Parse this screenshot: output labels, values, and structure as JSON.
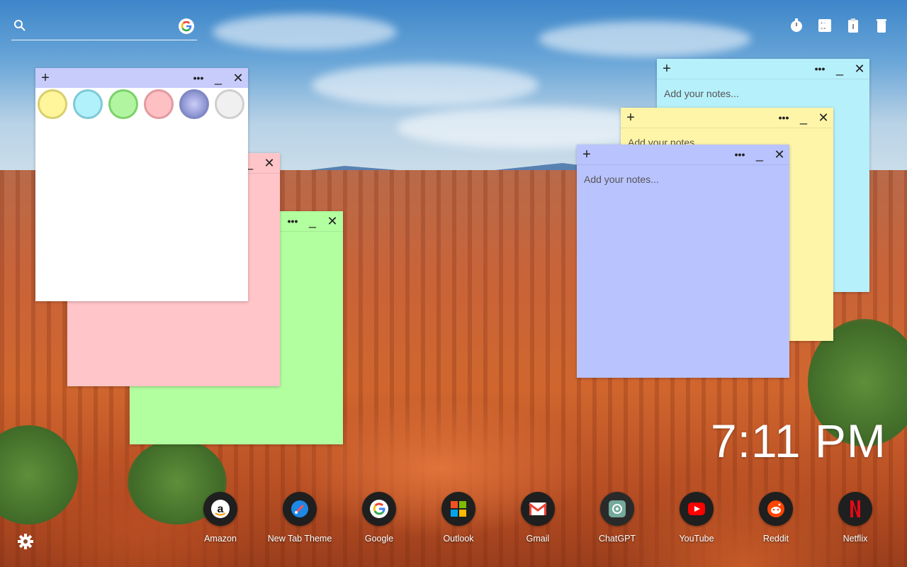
{
  "search": {
    "placeholder": "",
    "icon": "search-icon",
    "engine_icon": "google-icon"
  },
  "top_tools": [
    {
      "icon": "timer-icon"
    },
    {
      "icon": "calculator-icon"
    },
    {
      "icon": "clipboard-icon"
    },
    {
      "icon": "trash-icon"
    }
  ],
  "notes": {
    "placeholder": "Add your notes...",
    "new_label": "+",
    "menu_label": "•••",
    "minimize_label": "_",
    "close_label": "✕",
    "colors": {
      "white": "#ffffff",
      "pink": "#ffc5c8",
      "green": "#b2ffa0",
      "cyan": "#b6f0fb",
      "yellow": "#fff5a8",
      "blue": "#b9c3fe",
      "header_blue": "#c7ccfb"
    },
    "palette": [
      {
        "name": "yellow",
        "fill": "#fff59a",
        "ring": "#d9cf6e"
      },
      {
        "name": "cyan",
        "fill": "#b0f1fb",
        "ring": "#80c9d4"
      },
      {
        "name": "green",
        "fill": "#b1f5a0",
        "ring": "#7dd16b"
      },
      {
        "name": "pink",
        "fill": "#ffc0c4",
        "ring": "#e39aa0"
      },
      {
        "name": "blue",
        "fill": "#aab0e6",
        "ring": "#7f88c4",
        "selected": true
      },
      {
        "name": "white",
        "fill": "#f0f0f0",
        "ring": "#cfcfcf"
      }
    ]
  },
  "clock": {
    "time": "7:11 PM"
  },
  "dock": [
    {
      "label": "Amazon",
      "icon": "amazon-icon"
    },
    {
      "label": "New Tab Theme",
      "icon": "new-tab-theme-icon"
    },
    {
      "label": "Google",
      "icon": "google-icon"
    },
    {
      "label": "Outlook",
      "icon": "outlook-icon"
    },
    {
      "label": "Gmail",
      "icon": "gmail-icon"
    },
    {
      "label": "ChatGPT",
      "icon": "chatgpt-icon"
    },
    {
      "label": "YouTube",
      "icon": "youtube-icon"
    },
    {
      "label": "Reddit",
      "icon": "reddit-icon"
    },
    {
      "label": "Netflix",
      "icon": "netflix-icon"
    }
  ],
  "settings": {
    "icon": "gear-icon"
  }
}
